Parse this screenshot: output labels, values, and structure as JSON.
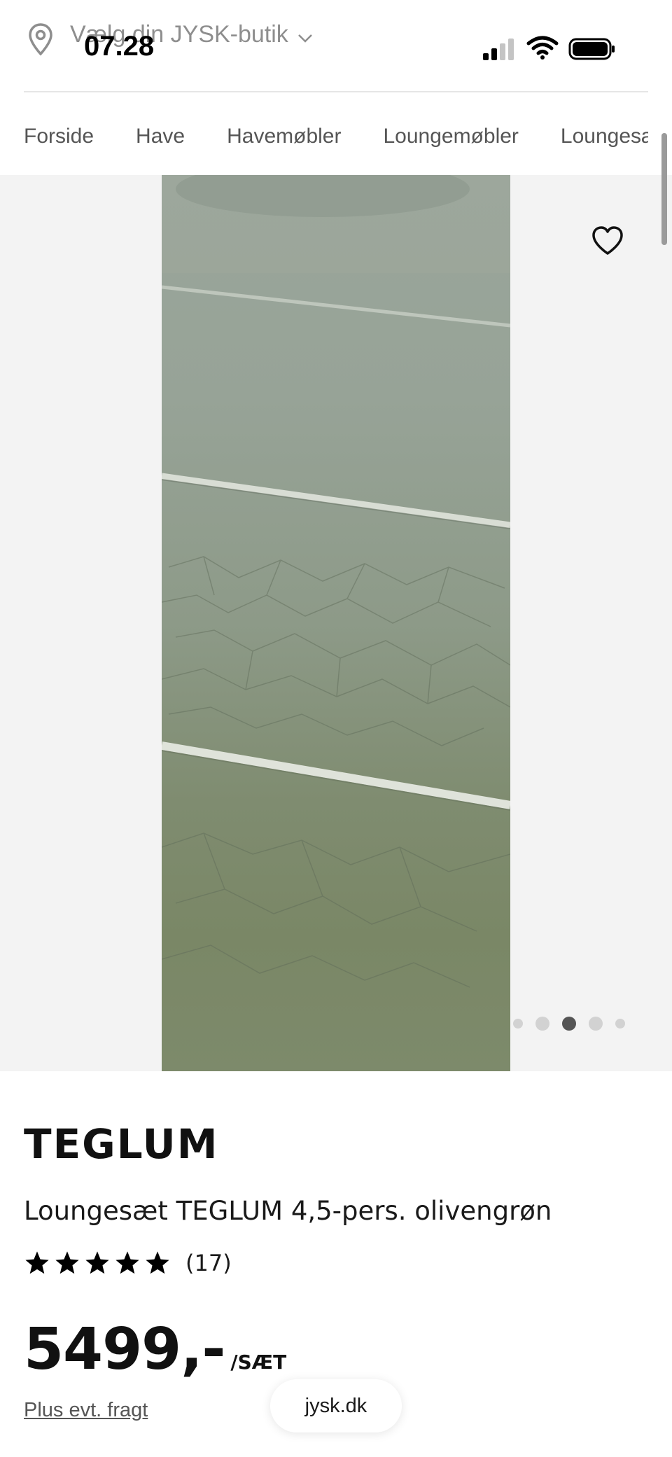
{
  "status_bar": {
    "time": "07.28"
  },
  "header": {
    "store_selector_label": "Vælg din JYSK-butik",
    "icons": [
      "location-pin-icon",
      "chevron-down-icon",
      "signal-icon",
      "wifi-icon",
      "battery-icon"
    ]
  },
  "breadcrumb": {
    "items": [
      "Forside",
      "Have",
      "Havemøbler",
      "Loungemøbler",
      "Loungesæt"
    ]
  },
  "gallery": {
    "image_count": 5,
    "active_index": 3,
    "icons": [
      "heart-icon"
    ]
  },
  "product": {
    "brand": "TEGLUM",
    "title": "Loungesæt TEGLUM 4,5-pers. olivengrøn",
    "rating": 5,
    "review_count": "(17)",
    "price": "5499,-",
    "price_unit": "/SÆT",
    "shipping_note": "Plus evt. fragt"
  },
  "browser": {
    "domain": "jysk.dk"
  },
  "colors": {
    "text": "#1a1a1a",
    "muted": "#8e8e8e",
    "gallery_bg": "#f3f3f3",
    "image_green": "#8d9a88",
    "active_dot": "#555555"
  }
}
